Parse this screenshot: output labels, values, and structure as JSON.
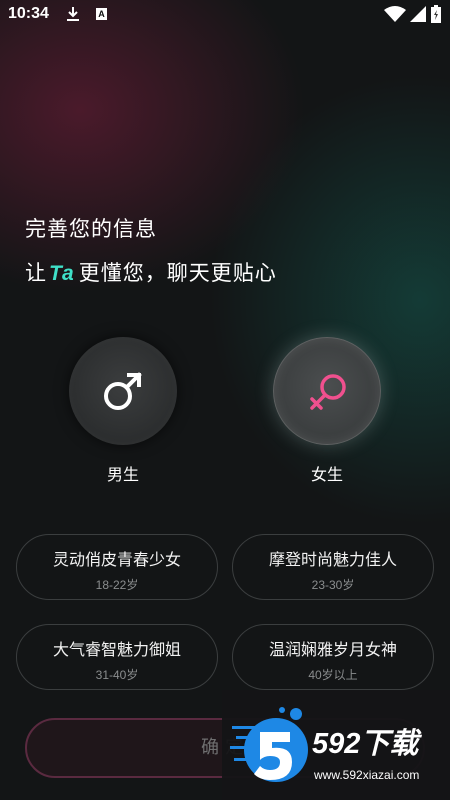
{
  "status_bar": {
    "time": "10:34",
    "notification_letter": "A",
    "icons": [
      "download-icon",
      "a-icon",
      "wifi-icon",
      "signal-icon",
      "battery-icon"
    ]
  },
  "header": {
    "title": "完善您的信息",
    "subtitle_prefix": "让",
    "subtitle_highlight": "Ta",
    "subtitle_suffix": "更懂您，聊天更贴心"
  },
  "gender": {
    "male_label": "男生",
    "female_label": "女生",
    "selected": "female",
    "male_color": "#ffffff",
    "female_color": "#f0508e"
  },
  "options": [
    {
      "title": "灵动俏皮青春少女",
      "age": "18-22岁"
    },
    {
      "title": "摩登时尚魅力佳人",
      "age": "23-30岁"
    },
    {
      "title": "大气睿智魅力御姐",
      "age": "31-40岁"
    },
    {
      "title": "温润娴雅岁月女神",
      "age": "40岁以上"
    }
  ],
  "confirm": {
    "label": "确定"
  },
  "watermark": {
    "brand": "592下载",
    "url": "www.592xiazai.com"
  },
  "colors": {
    "accent": "#3fe0c8",
    "female_pink": "#f0508e",
    "logo_blue": "#1e88e5"
  }
}
